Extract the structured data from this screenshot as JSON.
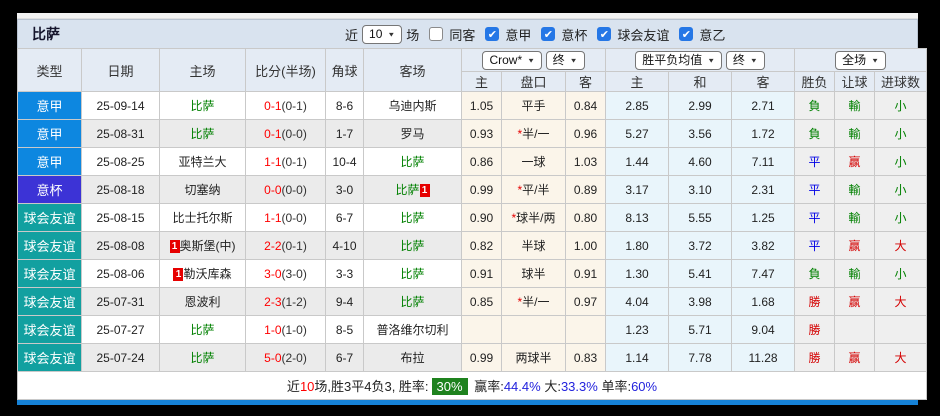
{
  "header": {
    "title": "比萨",
    "recent_label": "近",
    "recent_value": "10",
    "matches_label": "场",
    "same_away_label": "同客",
    "leagues": [
      {
        "label": "意甲",
        "checked": true
      },
      {
        "label": "意杯",
        "checked": true
      },
      {
        "label": "球会友谊",
        "checked": true
      },
      {
        "label": "意乙",
        "checked": true
      }
    ]
  },
  "dropdowns": {
    "odds_company": "Crow*",
    "odds_stage1": "终",
    "avg_label": "胜平负均值",
    "odds_stage2": "终",
    "scope": "全场"
  },
  "columns": {
    "type": "类型",
    "date": "日期",
    "home": "主场",
    "score": "比分(半场)",
    "corner": "角球",
    "away": "客场",
    "odds_home": "主",
    "handicap": "盘口",
    "odds_away": "客",
    "avg_home": "主",
    "avg_draw": "和",
    "avg_away": "客",
    "result": "胜负",
    "handicap_result": "让球",
    "goals": "进球数"
  },
  "rows": [
    {
      "type": "意甲",
      "tkey": "serie",
      "date": "25-09-14",
      "hbadge": "",
      "home": "比萨",
      "hcolor": "green",
      "score": "0-1",
      "half": "(0-1)",
      "corner": "8-6",
      "away": "乌迪内斯",
      "abadge": "",
      "acolor": "dark",
      "oh": "1.05",
      "hstar": "",
      "hc": "平手",
      "oa": "0.84",
      "ah": "2.85",
      "ad": "2.99",
      "aa": "2.71",
      "res": "負",
      "resc": "green",
      "hres": "輸",
      "hresc": "green",
      "goal": "小",
      "goalc": "green"
    },
    {
      "type": "意甲",
      "tkey": "serie",
      "date": "25-08-31",
      "hbadge": "",
      "home": "比萨",
      "hcolor": "green",
      "score": "0-1",
      "half": "(0-0)",
      "corner": "1-7",
      "away": "罗马",
      "abadge": "",
      "acolor": "dark",
      "oh": "0.93",
      "hstar": "*",
      "hc": "半/一",
      "oa": "0.96",
      "ah": "5.27",
      "ad": "3.56",
      "aa": "1.72",
      "res": "負",
      "resc": "green",
      "hres": "輸",
      "hresc": "green",
      "goal": "小",
      "goalc": "green"
    },
    {
      "type": "意甲",
      "tkey": "serie",
      "date": "25-08-25",
      "hbadge": "",
      "home": "亚特兰大",
      "hcolor": "dark",
      "score": "1-1",
      "half": "(0-1)",
      "corner": "10-4",
      "away": "比萨",
      "abadge": "",
      "acolor": "green",
      "oh": "0.86",
      "hstar": "",
      "hc": "一球",
      "oa": "1.03",
      "ah": "1.44",
      "ad": "4.60",
      "aa": "7.11",
      "res": "平",
      "resc": "blue",
      "hres": "赢",
      "hresc": "red",
      "goal": "小",
      "goalc": "green"
    },
    {
      "type": "意杯",
      "tkey": "cup",
      "date": "25-08-18",
      "hbadge": "",
      "home": "切塞纳",
      "hcolor": "dark",
      "score": "0-0",
      "half": "(0-0)",
      "corner": "3-0",
      "away": "比萨",
      "abadge": "1",
      "acolor": "green",
      "oh": "0.99",
      "hstar": "*",
      "hc": "平/半",
      "oa": "0.89",
      "ah": "3.17",
      "ad": "3.10",
      "aa": "2.31",
      "res": "平",
      "resc": "blue",
      "hres": "輸",
      "hresc": "green",
      "goal": "小",
      "goalc": "green"
    },
    {
      "type": "球会友谊",
      "tkey": "friendly",
      "date": "25-08-15",
      "hbadge": "",
      "home": "比士托尔斯",
      "hcolor": "dark",
      "score": "1-1",
      "half": "(0-0)",
      "corner": "6-7",
      "away": "比萨",
      "abadge": "",
      "acolor": "green",
      "oh": "0.90",
      "hstar": "*",
      "hc": "球半/两",
      "oa": "0.80",
      "ah": "8.13",
      "ad": "5.55",
      "aa": "1.25",
      "res": "平",
      "resc": "blue",
      "hres": "輸",
      "hresc": "green",
      "goal": "小",
      "goalc": "green"
    },
    {
      "type": "球会友谊",
      "tkey": "friendly",
      "date": "25-08-08",
      "hbadge": "1",
      "home": "奥斯堡(中)",
      "hcolor": "dark",
      "score": "2-2",
      "half": "(0-1)",
      "corner": "4-10",
      "away": "比萨",
      "abadge": "",
      "acolor": "green",
      "oh": "0.82",
      "hstar": "",
      "hc": "半球",
      "oa": "1.00",
      "ah": "1.80",
      "ad": "3.72",
      "aa": "3.82",
      "res": "平",
      "resc": "blue",
      "hres": "赢",
      "hresc": "red",
      "goal": "大",
      "goalc": "red"
    },
    {
      "type": "球会友谊",
      "tkey": "friendly",
      "date": "25-08-06",
      "hbadge": "1",
      "home": "勒沃库森",
      "hcolor": "dark",
      "score": "3-0",
      "half": "(3-0)",
      "corner": "3-3",
      "away": "比萨",
      "abadge": "",
      "acolor": "green",
      "oh": "0.91",
      "hstar": "",
      "hc": "球半",
      "oa": "0.91",
      "ah": "1.30",
      "ad": "5.41",
      "aa": "7.47",
      "res": "負",
      "resc": "green",
      "hres": "輸",
      "hresc": "green",
      "goal": "小",
      "goalc": "green"
    },
    {
      "type": "球会友谊",
      "tkey": "friendly",
      "date": "25-07-31",
      "hbadge": "",
      "home": "恩波利",
      "hcolor": "dark",
      "score": "2-3",
      "half": "(1-2)",
      "corner": "9-4",
      "away": "比萨",
      "abadge": "",
      "acolor": "green",
      "oh": "0.85",
      "hstar": "*",
      "hc": "半/一",
      "oa": "0.97",
      "ah": "4.04",
      "ad": "3.98",
      "aa": "1.68",
      "res": "勝",
      "resc": "red",
      "hres": "赢",
      "hresc": "red",
      "goal": "大",
      "goalc": "red"
    },
    {
      "type": "球会友谊",
      "tkey": "friendly",
      "date": "25-07-27",
      "hbadge": "",
      "home": "比萨",
      "hcolor": "green",
      "score": "1-0",
      "half": "(1-0)",
      "corner": "8-5",
      "away": "普洛维尔切利",
      "abadge": "",
      "acolor": "dark",
      "oh": "",
      "hstar": "",
      "hc": "",
      "oa": "",
      "ah": "1.23",
      "ad": "5.71",
      "aa": "9.04",
      "res": "勝",
      "resc": "red",
      "hres": "",
      "hresc": "red",
      "goal": "",
      "goalc": "red"
    },
    {
      "type": "球会友谊",
      "tkey": "friendly",
      "date": "25-07-24",
      "hbadge": "",
      "home": "比萨",
      "hcolor": "green",
      "score": "5-0",
      "half": "(2-0)",
      "corner": "6-7",
      "away": "布拉",
      "abadge": "",
      "acolor": "dark",
      "oh": "0.99",
      "hstar": "",
      "hc": "两球半",
      "oa": "0.83",
      "ah": "1.14",
      "ad": "7.78",
      "aa": "11.28",
      "res": "勝",
      "resc": "red",
      "hres": "赢",
      "hresc": "red",
      "goal": "大",
      "goalc": "red"
    }
  ],
  "footer": {
    "part1": "近",
    "num": "10",
    "part2": "场,胜3平4负3, 胜率:",
    "win_rate": "30%",
    "label_win": "赢率:",
    "val_win": "44.4%",
    "label_big": "大:",
    "val_big": "33.3%",
    "label_single": "单率:",
    "val_single": "60%"
  },
  "colors": {
    "serie_a": "#0d87e0",
    "cup": "#3c33d6",
    "friendly": "#12a0a0",
    "pisa_team": "#008000",
    "score_red": "#ff0000",
    "win_red": "#d40000",
    "draw_blue": "#0000e6",
    "lose_green": "#008000",
    "checkbox_blue": "#2577e6",
    "footer_badge_green": "#1e821e",
    "bottom_line_blue": "#1581d6"
  }
}
